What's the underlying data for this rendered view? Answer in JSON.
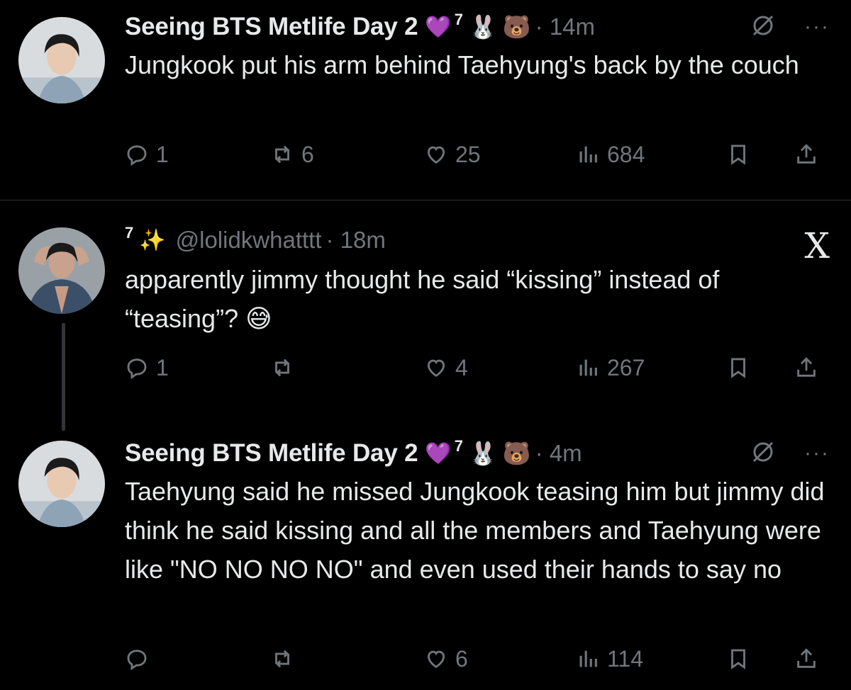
{
  "tweets": [
    {
      "author": "Seeing BTS Metlife Day 2",
      "heart": "💜",
      "badge_number": "7",
      "emoji1": "🐰",
      "emoji2": "🐻",
      "time": "· 14m",
      "text": "Jungkook put his arm behind Taehyung's back by the couch",
      "replies": "1",
      "reposts": "6",
      "likes": "25",
      "views": "684"
    },
    {
      "badge_number": "7",
      "sparkle": "✨",
      "handle": "@lolidkwhatttt",
      "time": "· 18m",
      "text": "apparently jimmy thought he said “kissing” instead of “teasing”? 😅",
      "replies": "1",
      "reposts": "",
      "likes": "4",
      "views": "267"
    },
    {
      "author": "Seeing BTS Metlife Day 2",
      "heart": "💜",
      "badge_number": "7",
      "emoji1": "🐰",
      "emoji2": "🐻",
      "time": "· 4m",
      "text": "Taehyung said he missed Jungkook teasing him but jimmy did think he said kissing and all the members and Taehyung were like \"NO NO NO NO\" and even used their hands to say no",
      "replies": "",
      "reposts": "",
      "likes": "6",
      "views": "114"
    }
  ],
  "icons": {
    "more": "···",
    "x_logo": "X"
  },
  "colors": {
    "background": "#000000",
    "text": "#e7e9ea",
    "muted": "#71767b",
    "heart_badge": "#8b3fe0"
  }
}
